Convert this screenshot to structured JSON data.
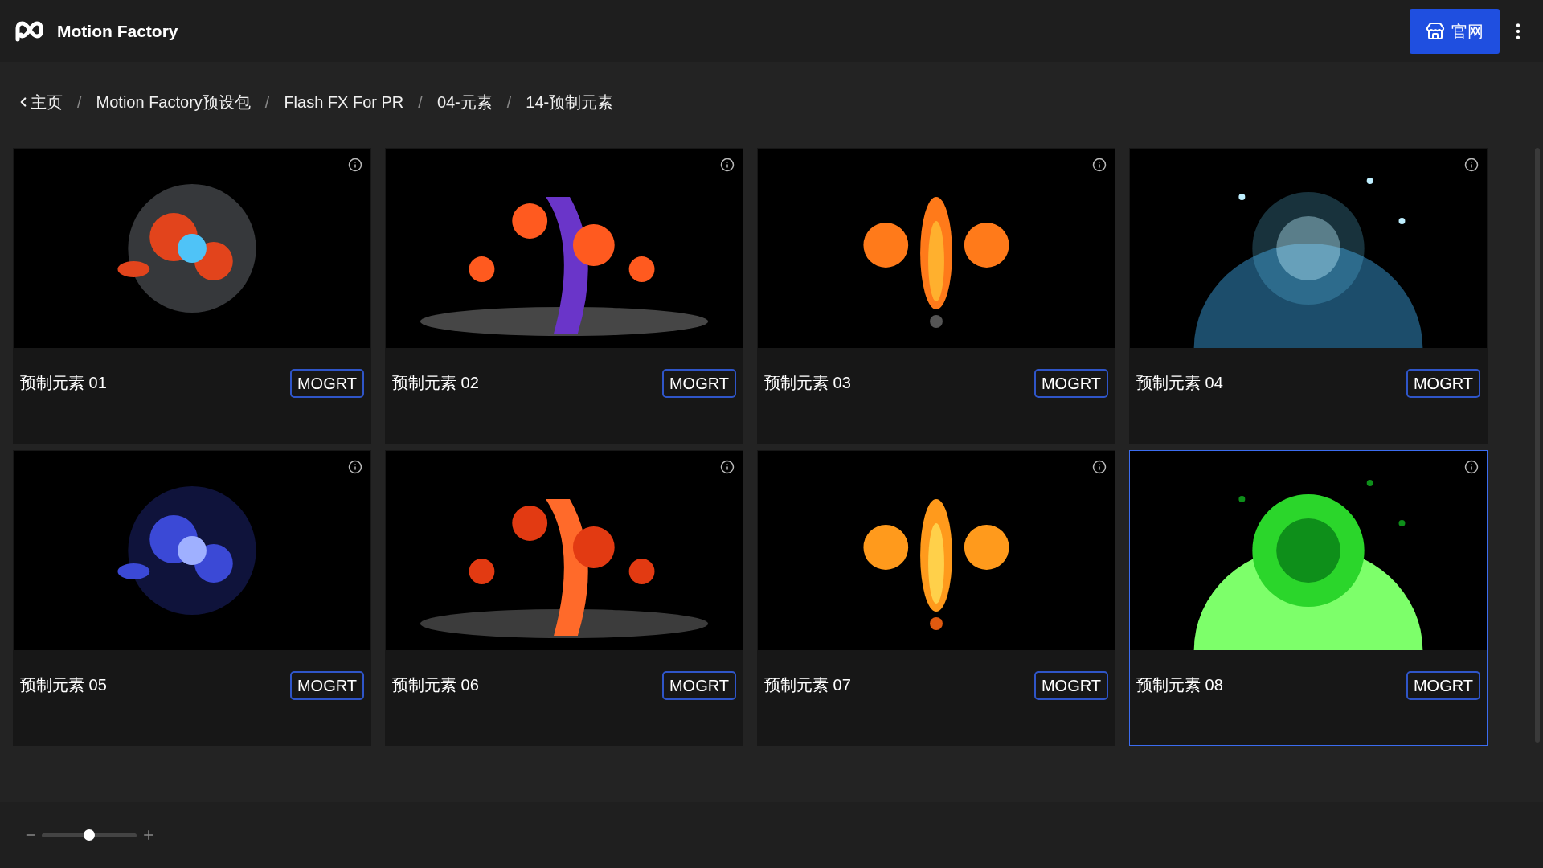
{
  "header": {
    "title": "Motion Factory",
    "site_button": "官网"
  },
  "breadcrumb": [
    {
      "label": "主页"
    },
    {
      "label": "Motion Factory预设包"
    },
    {
      "label": "Flash FX For PR"
    },
    {
      "label": "04-元素"
    },
    {
      "label": "14-预制元素"
    }
  ],
  "breadcrumb_separator": "/",
  "cards": [
    {
      "title": "预制元素 01",
      "badge": "MOGRT",
      "selected": false
    },
    {
      "title": "预制元素 02",
      "badge": "MOGRT",
      "selected": false
    },
    {
      "title": "预制元素 03",
      "badge": "MOGRT",
      "selected": false
    },
    {
      "title": "预制元素 04",
      "badge": "MOGRT",
      "selected": false
    },
    {
      "title": "预制元素 05",
      "badge": "MOGRT",
      "selected": false
    },
    {
      "title": "预制元素 06",
      "badge": "MOGRT",
      "selected": false
    },
    {
      "title": "预制元素 07",
      "badge": "MOGRT",
      "selected": false
    },
    {
      "title": "预制元素 08",
      "badge": "MOGRT",
      "selected": true
    }
  ],
  "zoom_slider": {
    "level": 0.5
  }
}
